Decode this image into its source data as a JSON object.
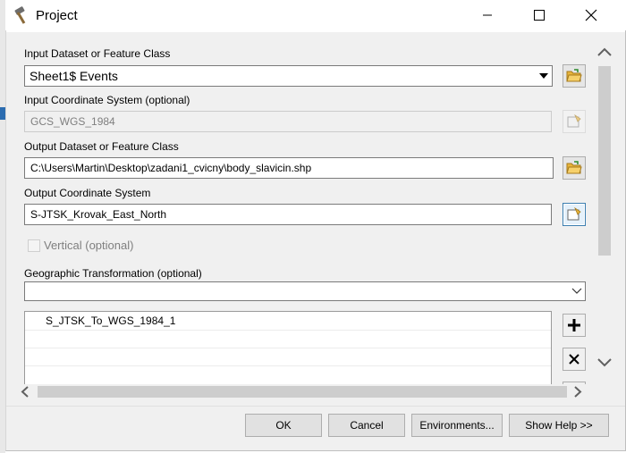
{
  "window": {
    "title": "Project"
  },
  "fields": {
    "input_dataset": {
      "label": "Input Dataset or Feature Class",
      "value": "Sheet1$ Events"
    },
    "input_cs": {
      "label": "Input Coordinate System (optional)",
      "value": "GCS_WGS_1984"
    },
    "output_dataset": {
      "label": "Output Dataset or Feature Class",
      "value": "C:\\Users\\Martin\\Desktop\\zadani1_cvicny\\body_slavicin.shp"
    },
    "output_cs": {
      "label": "Output Coordinate System",
      "value": "S-JTSK_Krovak_East_North"
    },
    "vertical": {
      "label": "Vertical (optional)",
      "checked": false
    },
    "geo_transform": {
      "label": "Geographic Transformation (optional)",
      "value": "",
      "list_items": [
        "S_JTSK_To_WGS_1984_1"
      ]
    }
  },
  "buttons": {
    "ok": "OK",
    "cancel": "Cancel",
    "environments": "Environments...",
    "show_help": "Show Help >>"
  },
  "icons": {
    "app": "hammer-icon",
    "browse": "open-folder-icon",
    "properties": "spatial-reference-icon",
    "add": "plus-icon",
    "remove": "x-icon"
  },
  "colors": {
    "accent": "#3c7fb1",
    "dialog_bg": "#f0f0f0",
    "folder": "#e8b43a"
  }
}
